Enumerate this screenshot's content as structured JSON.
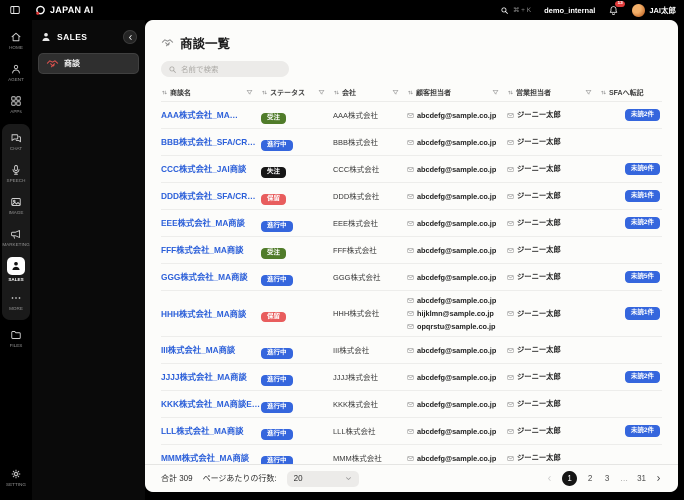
{
  "topbar": {
    "logo_text": "JAPAN AI",
    "search_shortcut": "⌘ + K",
    "workspace": "demo_internal",
    "notification_count": "13",
    "user_name": "JAI太郎"
  },
  "rail": {
    "items": [
      {
        "name": "home",
        "label": "HOME",
        "icon": "home-icon",
        "section": "top",
        "active": false
      },
      {
        "name": "agent",
        "label": "AGENT",
        "icon": "agent-icon",
        "section": "top",
        "active": false
      },
      {
        "name": "apps",
        "label": "APPs",
        "icon": "apps-icon",
        "section": "top",
        "active": false
      },
      {
        "name": "chat",
        "label": "CHAT",
        "icon": "chat-icon",
        "section": "boxed",
        "active": false
      },
      {
        "name": "speech",
        "label": "SPEECH",
        "icon": "mic-icon",
        "section": "boxed",
        "active": false
      },
      {
        "name": "image",
        "label": "IMAGE",
        "icon": "image-icon",
        "section": "boxed",
        "active": false
      },
      {
        "name": "marketing",
        "label": "MARKETING",
        "icon": "megaphone-icon",
        "section": "boxed",
        "active": false
      },
      {
        "name": "sales",
        "label": "SALES",
        "icon": "person-icon",
        "section": "boxed",
        "active": true
      },
      {
        "name": "more",
        "label": "MORE",
        "icon": "dots-icon",
        "section": "boxed",
        "active": false
      },
      {
        "name": "files",
        "label": "FILES",
        "icon": "folder-icon",
        "section": "mid",
        "active": false
      },
      {
        "name": "setting",
        "label": "SETTING",
        "icon": "gear-icon",
        "section": "bottom",
        "active": false
      }
    ]
  },
  "sidebar": {
    "title": "SALES",
    "items": [
      {
        "name": "deals",
        "label": "商談",
        "icon": "handshake-icon",
        "active": true
      }
    ]
  },
  "main": {
    "page_title": "商談一覧",
    "search_placeholder": "名前で検索",
    "table": {
      "columns": [
        "商談名",
        "ステータス",
        "会社",
        "顧客担当者",
        "営業担当者",
        "SFAへ転記"
      ],
      "rows": [
        {
          "name": "AAA株式会社_MA…",
          "status": "受注",
          "company": "AAA株式会社",
          "contacts": [
            "abcdefg@sample.co.jp"
          ],
          "sales_rep": "ジーニー太郎",
          "sfa": "未読2件"
        },
        {
          "name": "BBB株式会社_SFA/CR…",
          "status": "進行中",
          "company": "BBB株式会社",
          "contacts": [
            "abcdefg@sample.co.jp"
          ],
          "sales_rep": "ジーニー太郎",
          "sfa": ""
        },
        {
          "name": "CCC株式会社_JAI商談",
          "status": "失注",
          "company": "CCC株式会社",
          "contacts": [
            "abcdefg@sample.co.jp"
          ],
          "sales_rep": "ジーニー太郎",
          "sfa": "未読6件"
        },
        {
          "name": "DDD株式会社_SFA/CR…",
          "status": "保留",
          "company": "DDD株式会社",
          "contacts": [
            "abcdefg@sample.co.jp"
          ],
          "sales_rep": "ジーニー太郎",
          "sfa": "未読1件"
        },
        {
          "name": "EEE株式会社_MA商談",
          "status": "進行中",
          "company": "EEE株式会社",
          "contacts": [
            "abcdefg@sample.co.jp"
          ],
          "sales_rep": "ジーニー太郎",
          "sfa": "未読2件"
        },
        {
          "name": "FFF株式会社_MA商談",
          "status": "受注",
          "company": "FFF株式会社",
          "contacts": [
            "abcdefg@sample.co.jp"
          ],
          "sales_rep": "ジーニー太郎",
          "sfa": ""
        },
        {
          "name": "GGG株式会社_MA商談",
          "status": "進行中",
          "company": "GGG株式会社",
          "contacts": [
            "abcdefg@sample.co.jp"
          ],
          "sales_rep": "ジーニー太郎",
          "sfa": "未読5件"
        },
        {
          "name": "HHH株式会社_MA商談",
          "status": "保留",
          "company": "HHH株式会社",
          "contacts": [
            "abcdefg@sample.co.jp",
            "hijklmn@sample.co.jp",
            "opqrstu@sample.co.jp"
          ],
          "sales_rep": "ジーニー太郎",
          "sfa": "未読1件"
        },
        {
          "name": "III株式会社_MA商談",
          "status": "進行中",
          "company": "III株式会社",
          "contacts": [
            "abcdefg@sample.co.jp"
          ],
          "sales_rep": "ジーニー太郎",
          "sfa": ""
        },
        {
          "name": "JJJJ株式会社_MA商談",
          "status": "進行中",
          "company": "JJJJ株式会社",
          "contacts": [
            "abcdefg@sample.co.jp"
          ],
          "sales_rep": "ジーニー太郎",
          "sfa": "未読2件"
        },
        {
          "name": "KKK株式会社_MA商談E…",
          "status": "進行中",
          "company": "KKK株式会社",
          "contacts": [
            "abcdefg@sample.co.jp"
          ],
          "sales_rep": "ジーニー太郎",
          "sfa": ""
        },
        {
          "name": "LLL株式会社_MA商談",
          "status": "進行中",
          "company": "LLL株式会社",
          "contacts": [
            "abcdefg@sample.co.jp"
          ],
          "sales_rep": "ジーニー太郎",
          "sfa": "未読2件"
        },
        {
          "name": "MMM株式会社_MA商談",
          "status": "進行中",
          "company": "MMM株式会社",
          "contacts": [
            "abcdefg@sample.co.jp"
          ],
          "sales_rep": "ジーニー太郎",
          "sfa": ""
        }
      ]
    },
    "footer": {
      "total_label": "合計 309",
      "rows_per_page_label": "ページあたりの行数:",
      "rows_per_page_value": "20",
      "pages": [
        "1",
        "2",
        "3",
        "…",
        "31"
      ],
      "current_page": "1"
    }
  },
  "colors": {
    "accent_blue": "#3566dd",
    "link_blue": "#2b5fd9",
    "badge_red": "#e85d5d",
    "badge_green": "#507c2a",
    "badge_black": "#161616",
    "notification_red": "#e23b3b",
    "status": {
      "受注": "#507c2a",
      "進行中": "#3566dd",
      "失注": "#161616",
      "保留": "#e85d5d"
    }
  }
}
